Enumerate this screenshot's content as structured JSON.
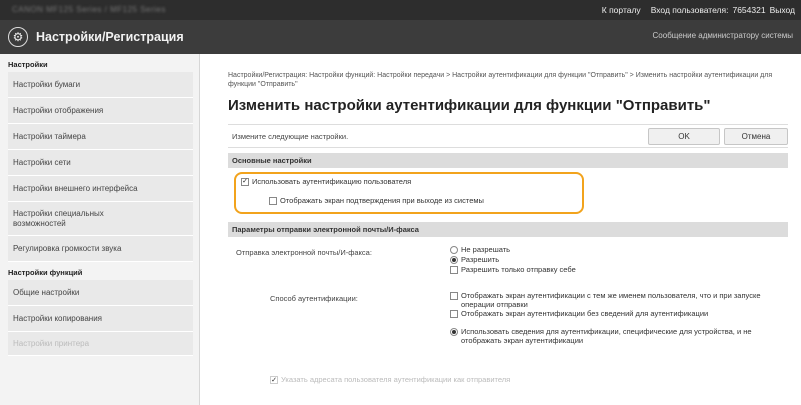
{
  "topbar": {
    "blurred_device": "CANON   MF125 Series / MF125 Series",
    "portal_link": "К порталу",
    "login_user_label": "Вход пользователя:",
    "login_user_id": "7654321",
    "logout_link": "Выход"
  },
  "header": {
    "title": "Настройки/Регистрация",
    "admin_message": "Сообщение администратору системы"
  },
  "sidebar": {
    "section1": "Настройки",
    "items1": [
      "Настройки бумаги",
      "Настройки отображения",
      "Настройки таймера",
      "Настройки сети",
      "Настройки внешнего интерфейса",
      "Настройки специальных возможностей",
      "Регулировка громкости звука"
    ],
    "section2": "Настройки функций",
    "items2": [
      "Общие настройки",
      "Настройки копирования",
      "Настройки принтера"
    ]
  },
  "main": {
    "breadcrumb": "Настройки/Регистрация: Настройки функций: Настройки передачи > Настройки аутентификации для функции \"Отправить\" > Изменить настройки аутентификации для функции \"Отправить\"",
    "page_title": "Изменить настройки аутентификации для функции \"Отправить\"",
    "instruction": "Измените следующие настройки.",
    "ok_label": "OK",
    "cancel_label": "Отмена",
    "basic_section": "Основные настройки",
    "use_user_auth": "Использовать аутентификацию пользователя",
    "show_confirm_on_logout": "Отображать экран подтверждения при выходе из системы",
    "email_section": "Параметры отправки электронной почты/И-факса",
    "email_send_label": "Отправка электронной почты/И-факса:",
    "email_send_options": [
      "Не разрешать",
      "Разрешить",
      "Разрешить только отправку себе"
    ],
    "auth_method_label": "Способ аутентификации:",
    "auth_method_options": [
      "Отображать экран аутентификации с тем же именем пользователя, что и при запуске операции отправки",
      "Отображать экран аутентификации без сведений для аутентификации",
      "Использовать сведения для аутентификации, специфические для устройства, и не отображать экран аутентификации"
    ],
    "sender_option": "Указать адресата пользователя аутентификации как отправителя"
  },
  "colors": {
    "highlight": "#f2a31c",
    "topbar": "#2d2d2d",
    "titlebar": "#3c3c3c"
  }
}
